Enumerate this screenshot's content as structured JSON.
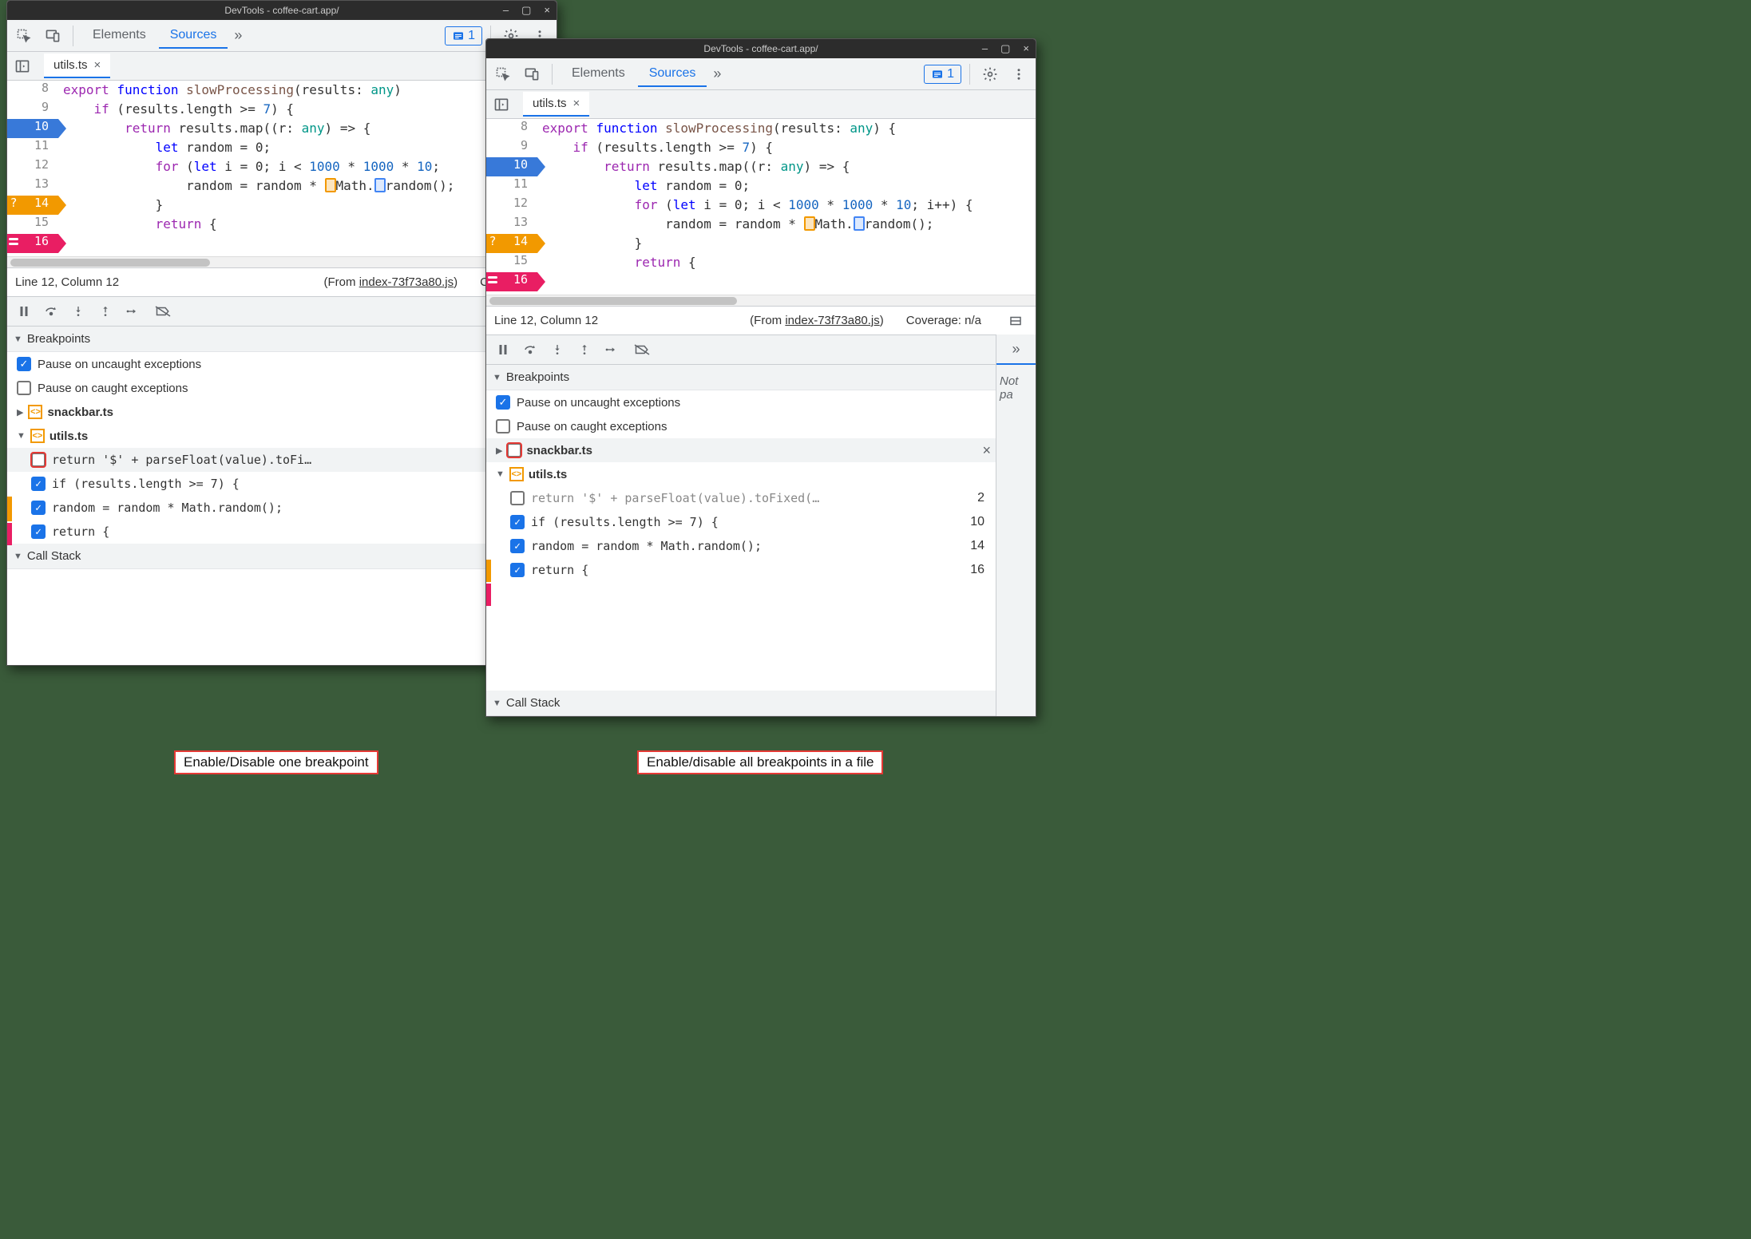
{
  "window_title": "DevTools - coffee-cart.app/",
  "tabs": {
    "elements": "Elements",
    "sources": "Sources"
  },
  "issues_count": "1",
  "file_tab": "utils.ts",
  "status": {
    "position": "Line 12, Column 12",
    "from_prefix": "(From ",
    "from_file": "index-73f73a80.js",
    "from_suffix": ")",
    "coverage_left": "Coverage: n/",
    "coverage_right": "Coverage: n/a"
  },
  "panes": {
    "breakpoints": "Breakpoints",
    "callstack": "Call Stack"
  },
  "bp_options": {
    "uncaught": "Pause on uncaught exceptions",
    "caught": "Pause on caught exceptions"
  },
  "files": {
    "snackbar": "snackbar.ts",
    "utils": "utils.ts"
  },
  "side_label": "Not pa",
  "code_lines": {
    "l8": "8",
    "l9": "9",
    "l10": "10",
    "l11": "11",
    "l12": "12",
    "l13": "13",
    "l14": "14",
    "l15": "15",
    "l16": "16",
    "qmark": "?"
  },
  "code_text": {
    "l9a": "export ",
    "l9b": "function ",
    "l9c": "slowProcessing",
    "l9d": "(",
    "l9e": "results",
    "l9f": ": ",
    "l9g": "any",
    "l9h_left": ")",
    "l9h_right": ") {",
    "l10": "    if (results.length >= 7) {",
    "l10_num": "7",
    "l11a": "        ",
    "l11b": "return ",
    "l11c": "results.map((",
    "l11d": "r",
    "l11e": ": ",
    "l11f": "any",
    "l11g": ") => {",
    "l12a": "            ",
    "l12b": "let ",
    "l12c": "random = 0;",
    "l13a": "            ",
    "l13b": "for ",
    "l13c": "(",
    "l13d": "let ",
    "l13e": "i = 0; i < ",
    "l13_n1": "1000",
    "l13_n2": "1000",
    "l13_n3": "10",
    "l13_sep": " * ",
    "l13_end_left": ";",
    "l13_end_right": "; i++) {",
    "l14a": "                random = random * ",
    "l14b": "Math.",
    "l14c": "random();",
    "l15": "            }",
    "l16a": "            ",
    "l16b": "return ",
    "l16c": "{"
  },
  "bp_list": {
    "b1_text_left": "return '$' + parseFloat(value).toFi…",
    "b1_text_right": "return '$' + parseFloat(value).toFixed(…",
    "b1_line": "2",
    "b2_text": "if (results.length >= 7) {",
    "b2_line": "10",
    "b3_text": "random = random * Math.random();",
    "b3_line": "14",
    "b4_text": "return {",
    "b4_line": "16"
  },
  "captions": {
    "left": "Enable/Disable one breakpoint",
    "right": "Enable/disable all breakpoints in a file"
  }
}
